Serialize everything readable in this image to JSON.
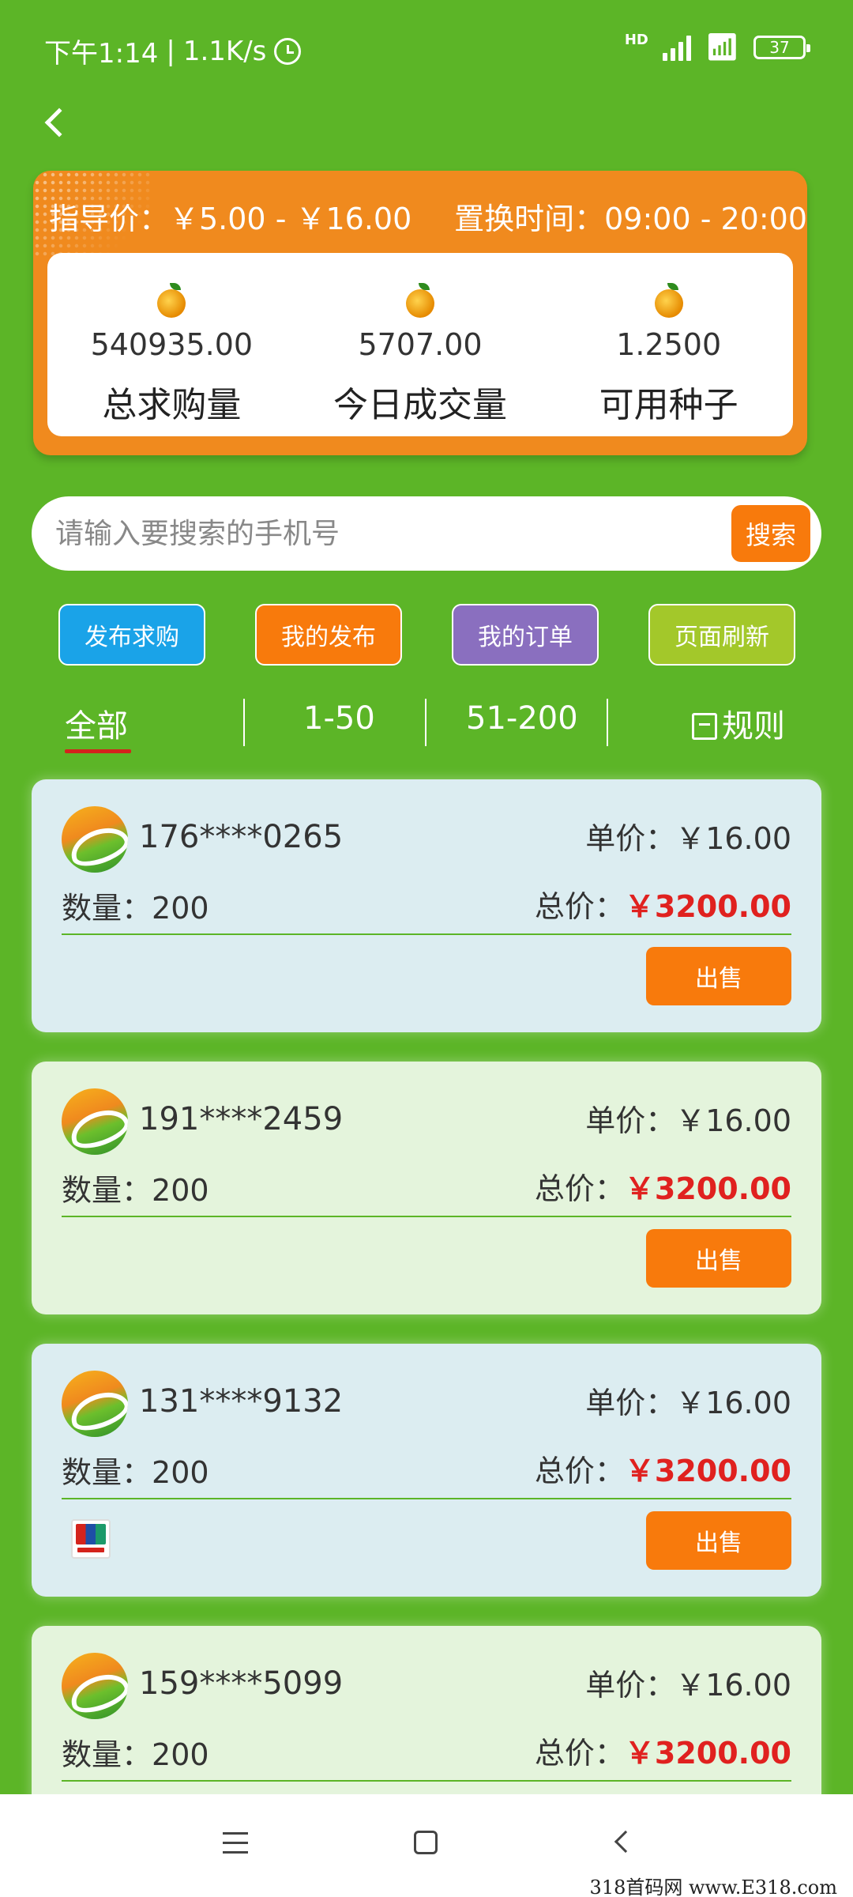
{
  "status_bar": {
    "time": "下午1:14",
    "speed": "1.1K/s",
    "network": "HD",
    "battery": "37"
  },
  "summary": {
    "guide_price": "指导价：￥5.00 - ￥16.00",
    "exchange_time": "置换时间：09:00 - 20:00",
    "stats": [
      {
        "value": "540935.00",
        "label": "总求购量"
      },
      {
        "value": "5707.00",
        "label": "今日成交量"
      },
      {
        "value": "1.2500",
        "label": "可用种子"
      }
    ]
  },
  "search": {
    "placeholder": "请输入要搜索的手机号",
    "button": "搜索"
  },
  "actions": [
    {
      "label": "发布求购",
      "color": "#1aa3e8"
    },
    {
      "label": "我的发布",
      "color": "#f87a0c"
    },
    {
      "label": "我的订单",
      "color": "#8a6fbf"
    },
    {
      "label": "页面刷新",
      "color": "#a3c82a"
    }
  ],
  "tabs": {
    "all": "全部",
    "range1": "1-50",
    "range2": "51-200",
    "rules": "规则"
  },
  "labels": {
    "unit_price": "单价：",
    "total_price": "总价：",
    "quantity": "数量：",
    "sell": "出售"
  },
  "orders": [
    {
      "phone": "176****0265",
      "quantity": "200",
      "unit_price": "￥16.00",
      "total": "￥3200.00"
    },
    {
      "phone": "191****2459",
      "quantity": "200",
      "unit_price": "￥16.00",
      "total": "￥3200.00"
    },
    {
      "phone": "131****9132",
      "quantity": "200",
      "unit_price": "￥16.00",
      "total": "￥3200.00"
    },
    {
      "phone": "159****5099",
      "quantity": "200",
      "unit_price": "￥16.00",
      "total": "￥3200.00"
    }
  ],
  "watermark": "318首码网 www.E318.com"
}
